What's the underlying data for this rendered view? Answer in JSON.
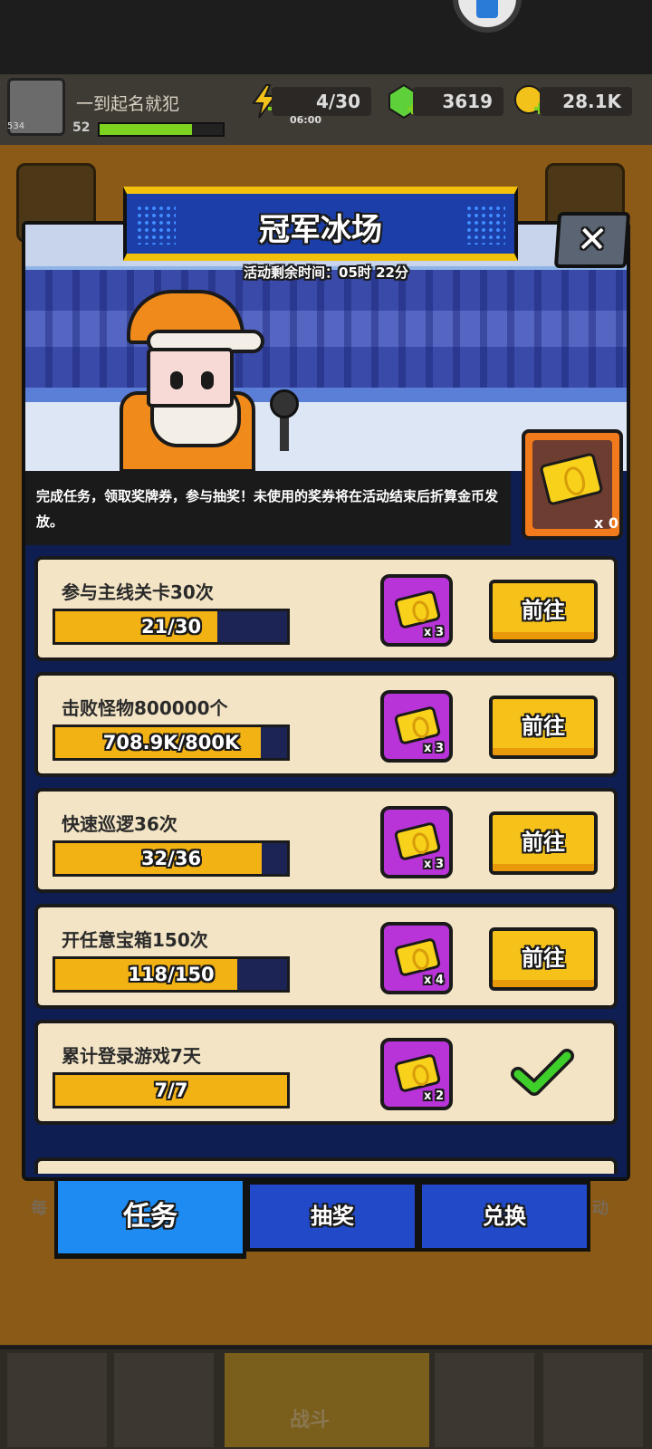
{
  "header": {
    "player_name": "一到起名就犯",
    "player_level": "52",
    "avatar_level": "534",
    "xp_fraction": 0.75,
    "energy": "4/30",
    "energy_timer": "06:00",
    "gems": "3619",
    "gold": "28.1K"
  },
  "event": {
    "title": "冠军冰场",
    "timer": "活动剩余时间：05时 22分",
    "close_label": "✕",
    "description": "完成任务，领取奖牌券，参与抽奖！未使用的奖券将在活动结束后折算金币发放。",
    "ticket_count": "x 0"
  },
  "tasks": [
    {
      "label": "参与主线关卡30次",
      "progress": "21/30",
      "fraction": 0.7,
      "reward": "x 3",
      "action": "前往",
      "done": false
    },
    {
      "label": "击败怪物800000个",
      "progress": "708.9K/800K",
      "fraction": 0.886,
      "reward": "x 3",
      "action": "前往",
      "done": false
    },
    {
      "label": "快速巡逻36次",
      "progress": "32/36",
      "fraction": 0.889,
      "reward": "x 3",
      "action": "前往",
      "done": false
    },
    {
      "label": "开任意宝箱150次",
      "progress": "118/150",
      "fraction": 0.787,
      "reward": "x 4",
      "action": "前往",
      "done": false
    },
    {
      "label": "累计登录游戏7天",
      "progress": "7/7",
      "fraction": 1.0,
      "reward": "x 2",
      "action": "",
      "done": true
    }
  ],
  "tabs": [
    {
      "label": "任务",
      "active": true
    },
    {
      "label": "抽奖",
      "active": false
    },
    {
      "label": "兑换",
      "active": false
    }
  ],
  "background": {
    "left_tab_partial": "每",
    "right_tab_partial": "动",
    "bottom_center": "战斗"
  },
  "colors": {
    "progress_fill": "#f3b214",
    "go_button": "#f6c21a",
    "reward_purple": "#b834d8",
    "tab_active": "#1d8bf2",
    "tab_inactive": "#2149c8",
    "check_green": "#3fcf2a"
  }
}
